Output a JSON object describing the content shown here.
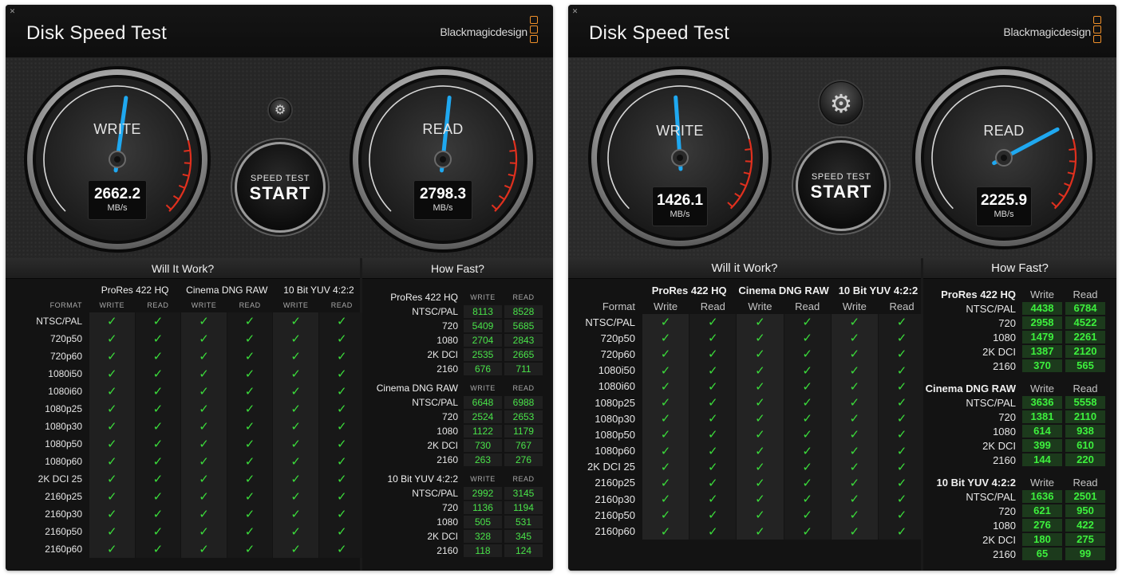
{
  "windows": [
    {
      "close_glyph": "✕",
      "title": "Disk Speed Test",
      "brand": "Blackmagicdesign",
      "write_gauge": {
        "label": "WRITE",
        "value": "2662.2",
        "unit": "MB/s",
        "needle_angle_deg": 8
      },
      "read_gauge": {
        "label": "READ",
        "value": "2798.3",
        "unit": "MB/s",
        "needle_angle_deg": 6
      },
      "gear_icon": "⚙",
      "start_button": {
        "line1": "SPEED TEST",
        "line2": "START"
      },
      "will_it_work": {
        "heading": "Will It Work?",
        "format_label": "FORMAT",
        "codecs": [
          "ProRes 422 HQ",
          "Cinema DNG RAW",
          "10 Bit YUV 4:2:2"
        ],
        "write_label": "WRITE",
        "read_label": "READ",
        "check_glyph": "✓",
        "formats": [
          "NTSC/PAL",
          "720p50",
          "720p60",
          "1080i50",
          "1080i60",
          "1080p25",
          "1080p30",
          "1080p50",
          "1080p60",
          "2K DCI 25",
          "2160p25",
          "2160p30",
          "2160p50",
          "2160p60"
        ]
      },
      "how_fast": {
        "heading": "How Fast?",
        "write_label": "WRITE",
        "read_label": "READ",
        "groups": [
          {
            "name": "ProRes 422 HQ",
            "rows": [
              {
                "res": "NTSC/PAL",
                "write": "8113",
                "read": "8528"
              },
              {
                "res": "720",
                "write": "5409",
                "read": "5685"
              },
              {
                "res": "1080",
                "write": "2704",
                "read": "2843"
              },
              {
                "res": "2K DCI",
                "write": "2535",
                "read": "2665"
              },
              {
                "res": "2160",
                "write": "676",
                "read": "711"
              }
            ]
          },
          {
            "name": "Cinema DNG RAW",
            "rows": [
              {
                "res": "NTSC/PAL",
                "write": "6648",
                "read": "6988"
              },
              {
                "res": "720",
                "write": "2524",
                "read": "2653"
              },
              {
                "res": "1080",
                "write": "1122",
                "read": "1179"
              },
              {
                "res": "2K DCI",
                "write": "730",
                "read": "767"
              },
              {
                "res": "2160",
                "write": "263",
                "read": "276"
              }
            ]
          },
          {
            "name": "10 Bit YUV 4:2:2",
            "rows": [
              {
                "res": "NTSC/PAL",
                "write": "2992",
                "read": "3145"
              },
              {
                "res": "720",
                "write": "1136",
                "read": "1194"
              },
              {
                "res": "1080",
                "write": "505",
                "read": "531"
              },
              {
                "res": "2K DCI",
                "write": "328",
                "read": "345"
              },
              {
                "res": "2160",
                "write": "118",
                "read": "124"
              }
            ]
          }
        ]
      }
    },
    {
      "close_glyph": "✕",
      "title": "Disk Speed Test",
      "brand": "Blackmagicdesign",
      "write_gauge": {
        "label": "WRITE",
        "value": "1426.1",
        "unit": "MB/s",
        "needle_angle_deg": -4
      },
      "read_gauge": {
        "label": "READ",
        "value": "2225.9",
        "unit": "MB/s",
        "needle_angle_deg": 62
      },
      "gear_icon": "⚙",
      "start_button": {
        "line1": "SPEED TEST",
        "line2": "START"
      },
      "will_it_work": {
        "heading": "Will it Work?",
        "format_label": "Format",
        "codecs": [
          "ProRes 422 HQ",
          "Cinema DNG RAW",
          "10 Bit YUV 4:2:2"
        ],
        "write_label": "Write",
        "read_label": "Read",
        "check_glyph": "✓",
        "formats": [
          "NTSC/PAL",
          "720p50",
          "720p60",
          "1080i50",
          "1080i60",
          "1080p25",
          "1080p30",
          "1080p50",
          "1080p60",
          "2K DCI 25",
          "2160p25",
          "2160p30",
          "2160p50",
          "2160p60"
        ]
      },
      "how_fast": {
        "heading": "How Fast?",
        "write_label": "Write",
        "read_label": "Read",
        "groups": [
          {
            "name": "ProRes 422 HQ",
            "rows": [
              {
                "res": "NTSC/PAL",
                "write": "4438",
                "read": "6784"
              },
              {
                "res": "720",
                "write": "2958",
                "read": "4522"
              },
              {
                "res": "1080",
                "write": "1479",
                "read": "2261"
              },
              {
                "res": "2K DCI",
                "write": "1387",
                "read": "2120"
              },
              {
                "res": "2160",
                "write": "370",
                "read": "565"
              }
            ]
          },
          {
            "name": "Cinema DNG RAW",
            "rows": [
              {
                "res": "NTSC/PAL",
                "write": "3636",
                "read": "5558"
              },
              {
                "res": "720",
                "write": "1381",
                "read": "2110"
              },
              {
                "res": "1080",
                "write": "614",
                "read": "938"
              },
              {
                "res": "2K DCI",
                "write": "399",
                "read": "610"
              },
              {
                "res": "2160",
                "write": "144",
                "read": "220"
              }
            ]
          },
          {
            "name": "10 Bit YUV 4:2:2",
            "rows": [
              {
                "res": "NTSC/PAL",
                "write": "1636",
                "read": "2501"
              },
              {
                "res": "720",
                "write": "621",
                "read": "950"
              },
              {
                "res": "1080",
                "write": "276",
                "read": "422"
              },
              {
                "res": "2K DCI",
                "write": "180",
                "read": "275"
              },
              {
                "res": "2160",
                "write": "65",
                "read": "99"
              }
            ]
          }
        ]
      }
    }
  ]
}
